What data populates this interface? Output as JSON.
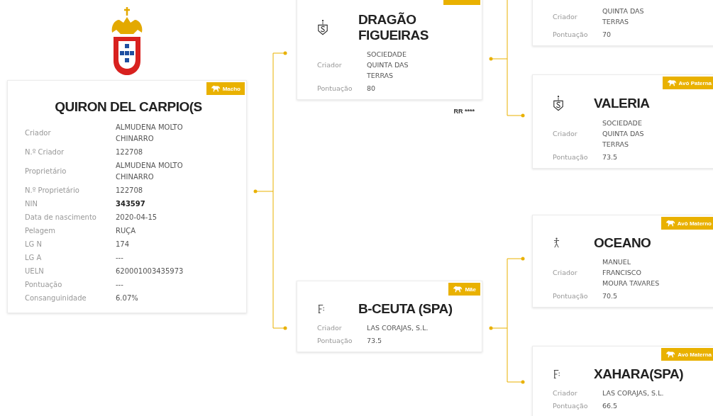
{
  "subject": {
    "badge": "Macho",
    "name": "QUIRON DEL CARPIO(S",
    "rows": [
      {
        "label": "Criador",
        "value": "ALMUDENA MOLTO CHINARRO",
        "bold": false
      },
      {
        "label": "N.º Criador",
        "value": "122708",
        "bold": false
      },
      {
        "label": "Proprietário",
        "value": "ALMUDENA MOLTO CHINARRO",
        "bold": false
      },
      {
        "label": "N.º Proprietário",
        "value": "122708",
        "bold": false
      },
      {
        "label": "NIN",
        "value": "343597",
        "bold": true
      },
      {
        "label": "Data de nascimento",
        "value": "2020-04-15",
        "bold": false
      },
      {
        "label": "Pelagem",
        "value": "RUÇA",
        "bold": false
      },
      {
        "label": "LG N",
        "value": "174",
        "bold": false
      },
      {
        "label": "LG A",
        "value": "---",
        "bold": false
      },
      {
        "label": "UELN",
        "value": "620001003435973",
        "bold": false
      },
      {
        "label": "Pontuação",
        "value": "---",
        "bold": false
      },
      {
        "label": "Consanguinidade",
        "value": "6.07%",
        "bold": false
      }
    ]
  },
  "ancestors": [
    {
      "kind": "shield",
      "name": "DRAGÃO FIGUEIRAS",
      "rows": [
        {
          "label": "Criador",
          "value": "SOCIEDADE QUINTA DAS TERRAS"
        },
        {
          "label": "Pontuação",
          "value": "80"
        }
      ],
      "rating": "RR ****"
    },
    {
      "rows": [
        {
          "label": "Criador",
          "value": "QUINTA DAS TERRAS"
        },
        {
          "label": "Pontuação",
          "value": "70"
        }
      ]
    },
    {
      "kind": "shield",
      "badge": "Avó Paterna",
      "name": "VALERIA",
      "rows": [
        {
          "label": "Criador",
          "value": "SOCIEDADE QUINTA DAS TERRAS"
        },
        {
          "label": "Pontuação",
          "value": "73.5"
        }
      ]
    },
    {
      "kind": "brand",
      "badge": "Mãe",
      "name": "B-CEUTA (SPA)",
      "rows": [
        {
          "label": "Criador",
          "value": "LAS CORAJAS, S.L."
        },
        {
          "label": "Pontuação",
          "value": "73.5"
        }
      ]
    },
    {
      "kind": "walker",
      "badge": "Avô Materno",
      "name": "OCEANO",
      "rows": [
        {
          "label": "Criador",
          "value": "MANUEL FRANCISCO MOURA TAVARES"
        },
        {
          "label": "Pontuação",
          "value": "70.5"
        }
      ]
    },
    {
      "kind": "brand",
      "badge": "Avó Materna",
      "name": "XAHARA(SPA)",
      "rows": [
        {
          "label": "Criador",
          "value": "LAS CORAJAS, S.L."
        },
        {
          "label": "Pontuação",
          "value": "66.5"
        }
      ]
    }
  ]
}
